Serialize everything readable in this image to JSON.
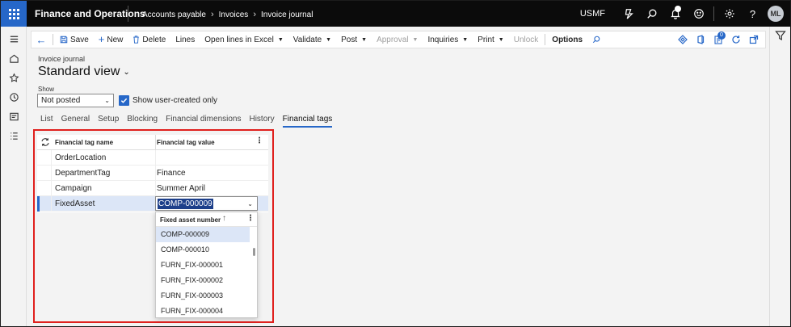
{
  "topbar": {
    "app_name": "Finance and Operations",
    "breadcrumb": [
      "Accounts payable",
      "Invoices",
      "Invoice journal"
    ],
    "company": "USMF",
    "user_initials": "ML"
  },
  "actions": {
    "save": "Save",
    "new": "New",
    "delete": "Delete",
    "lines": "Lines",
    "open_lines_excel": "Open lines in Excel",
    "validate": "Validate",
    "post": "Post",
    "approval": "Approval",
    "inquiries": "Inquiries",
    "print": "Print",
    "unlock": "Unlock",
    "options": "Options",
    "notification_count": "0"
  },
  "page": {
    "subtitle": "Invoice journal",
    "title": "Standard view"
  },
  "filters": {
    "show_label": "Show",
    "show_value": "Not posted",
    "user_created_label": "Show user-created only"
  },
  "tabs": [
    "List",
    "General",
    "Setup",
    "Blocking",
    "Financial dimensions",
    "History",
    "Financial tags"
  ],
  "grid": {
    "col_name": "Financial tag name",
    "col_value": "Financial tag value",
    "rows": [
      {
        "name": "OrderLocation",
        "value": ""
      },
      {
        "name": "DepartmentTag",
        "value": "Finance"
      },
      {
        "name": "Campaign",
        "value": "Summer April"
      },
      {
        "name": "FixedAsset",
        "value": "COMP-000009"
      }
    ]
  },
  "lookup": {
    "header": "Fixed asset number",
    "items": [
      "COMP-000009",
      "COMP-000010",
      "FURN_FIX-000001",
      "FURN_FIX-000002",
      "FURN_FIX-000003",
      "FURN_FIX-000004"
    ]
  },
  "colors": {
    "accent": "#2667c8",
    "highlight_box": "#e0201d",
    "selected_row": "#dce6f7"
  }
}
